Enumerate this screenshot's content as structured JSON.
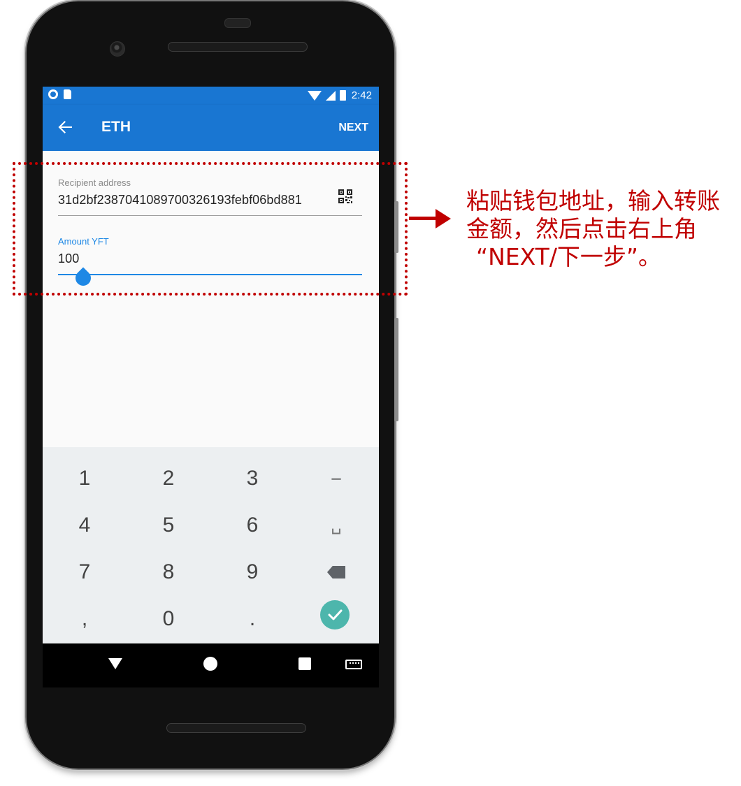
{
  "status_bar": {
    "time": "2:42"
  },
  "app_bar": {
    "title": "ETH",
    "action_label": "NEXT",
    "back_icon": "arrow-back-icon"
  },
  "form": {
    "recipient": {
      "label": "Recipient address",
      "value": "31d2bf2387041089700326193febf06bd881"
    },
    "amount": {
      "label": "Amount YFT",
      "value": "100"
    }
  },
  "keypad": {
    "keys": [
      "1",
      "2",
      "3",
      "–",
      "4",
      "5",
      "6",
      "␣",
      "7",
      "8",
      "9",
      "⌫",
      ",",
      "0",
      ".",
      "✓"
    ]
  },
  "annotation": {
    "lines": [
      "粘贴钱包地址，输入转账",
      "金额，然后点击右上角",
      "“NEXT/下一步”。"
    ],
    "color": "#c00000"
  },
  "theme": {
    "primary": "#1976d2",
    "accent": "#1e88e5",
    "done": "#4db6ac"
  }
}
